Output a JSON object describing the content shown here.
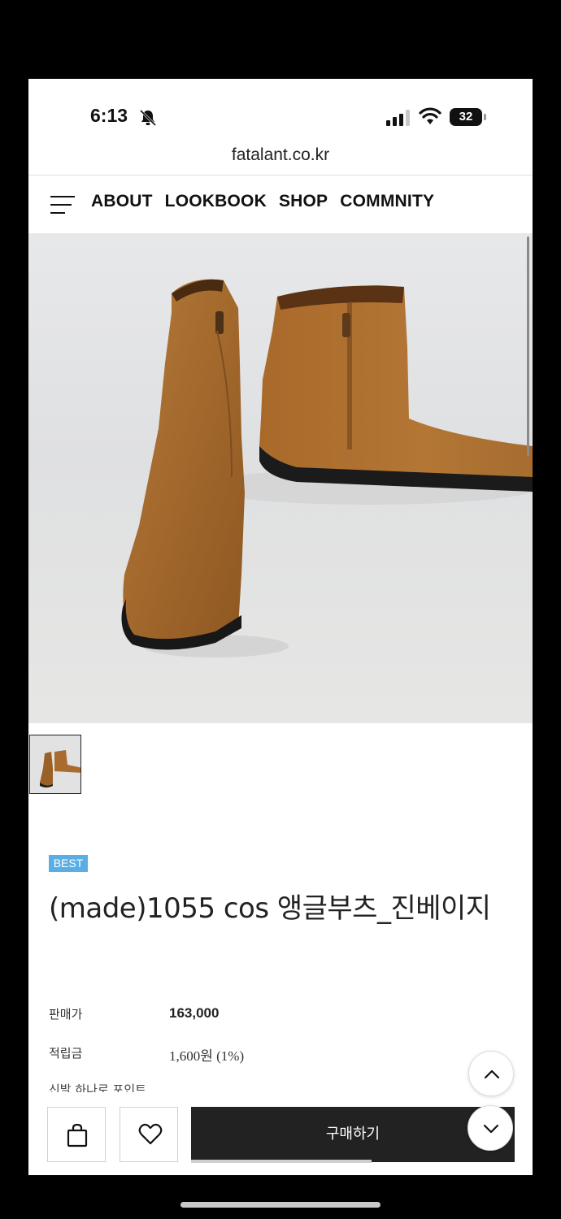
{
  "status_bar": {
    "time": "6:13",
    "battery_level": "32",
    "icons": [
      "bell-slash-icon",
      "signal-icon",
      "wifi-icon",
      "battery-icon"
    ]
  },
  "browser": {
    "url": "fatalant.co.kr"
  },
  "nav": {
    "menu_icon": "hamburger-menu-icon",
    "links": [
      "ABOUT",
      "LOOKBOOK",
      "SHOP",
      "COMMNITY"
    ]
  },
  "product": {
    "badge": "BEST",
    "name": "(made)1055 cos 앵글부츠_진베이지",
    "price_label": "판매가",
    "price": "163,000",
    "points_label": "적립금",
    "points": "1,600원 (1%)",
    "partial_text": "신발 하나로 포인트"
  },
  "actions": {
    "cart_icon": "shopping-bag-icon",
    "wishlist_icon": "heart-icon",
    "buy_label": "구매하기",
    "scroll_up_icon": "chevron-up-icon",
    "scroll_down_icon": "chevron-down-icon"
  },
  "colors": {
    "badge": "#5aaee6",
    "buy_button": "#222222",
    "boot_suede": "#a2682c"
  }
}
